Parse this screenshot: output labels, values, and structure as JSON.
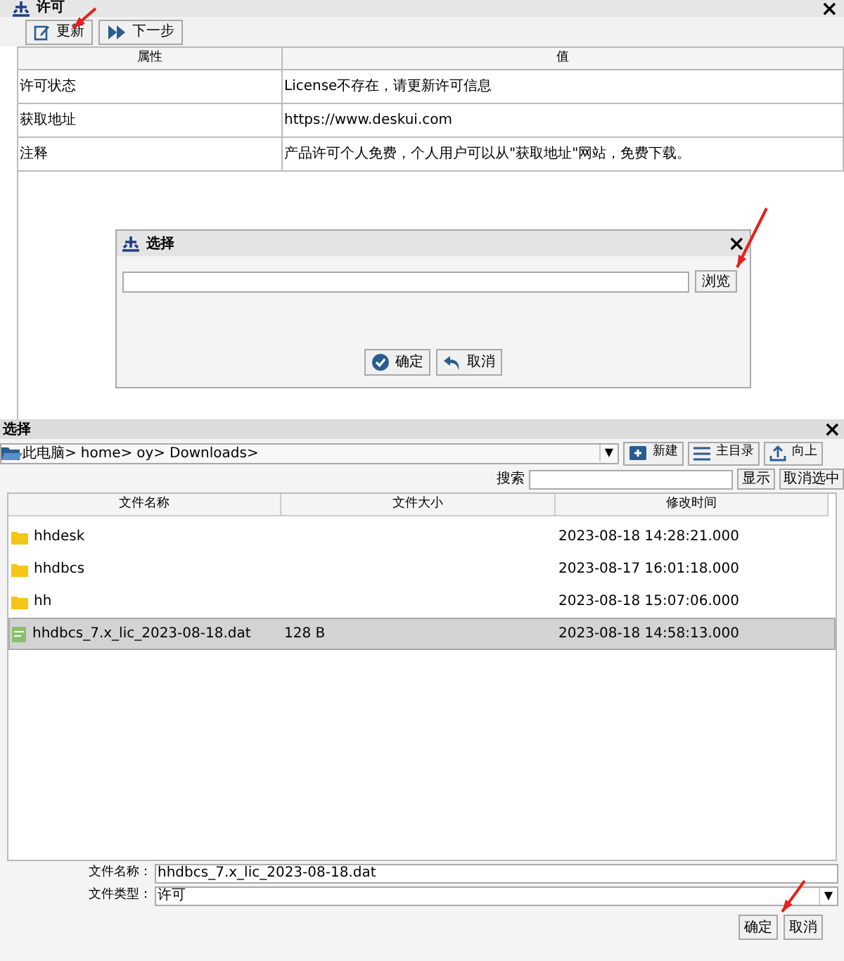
{
  "license_window": {
    "title": "许可",
    "close": "×",
    "toolbar": [
      "更新",
      "下一步"
    ],
    "table": {
      "columns": [
        "属性",
        "值"
      ],
      "rows": [
        [
          "许可状态",
          "License不存在，请更新许可信息"
        ],
        [
          "获取地址",
          "https://www.deskui.com"
        ],
        [
          "注释",
          "产品许可个人免费，个人用户可以从\"获取地址\"网站，免费下载。"
        ]
      ]
    }
  },
  "select_dialog": {
    "title": "选择",
    "close": "×",
    "browse_button": "浏览",
    "buttons": [
      "确定",
      "取消"
    ]
  },
  "file_chooser": {
    "title": "选择",
    "close": "×",
    "path": [
      "此电脑>",
      "home>",
      "oy>",
      "Downloads>"
    ],
    "path_dropdown": "▼",
    "toolbar": [
      "新建",
      "主目录",
      "向上"
    ],
    "search_label": "搜索",
    "show_button": "显示",
    "deselect_button": "取消选中",
    "columns": [
      "文件名称",
      "文件大小",
      "修改时间"
    ],
    "files": [
      {
        "kind": "folder",
        "name": "hhdesk",
        "modified": "2023-08-18 14:28:21.000",
        "selected": false
      },
      {
        "kind": "folder",
        "name": "hhdbcs",
        "modified": "2023-08-17 16:01:18.000",
        "selected": false
      },
      {
        "kind": "folder",
        "name": "hh",
        "modified": "2023-08-18 15:07:06.000",
        "selected": false
      },
      {
        "kind": "file",
        "name": "hhdbcs_7.x_lic_2023-08-18.dat",
        "size": "128 B",
        "modified": "2023-08-18 14:58:13.000",
        "selected": true
      }
    ],
    "file_name_label": "文件名称：",
    "file_name": "hhdbcs_7.x_lic_2023-08-18.dat",
    "file_type_label": "文件类型：",
    "file_type": "许可",
    "file_type_dropdown": "▼",
    "buttons": [
      "确定",
      "取消"
    ]
  }
}
